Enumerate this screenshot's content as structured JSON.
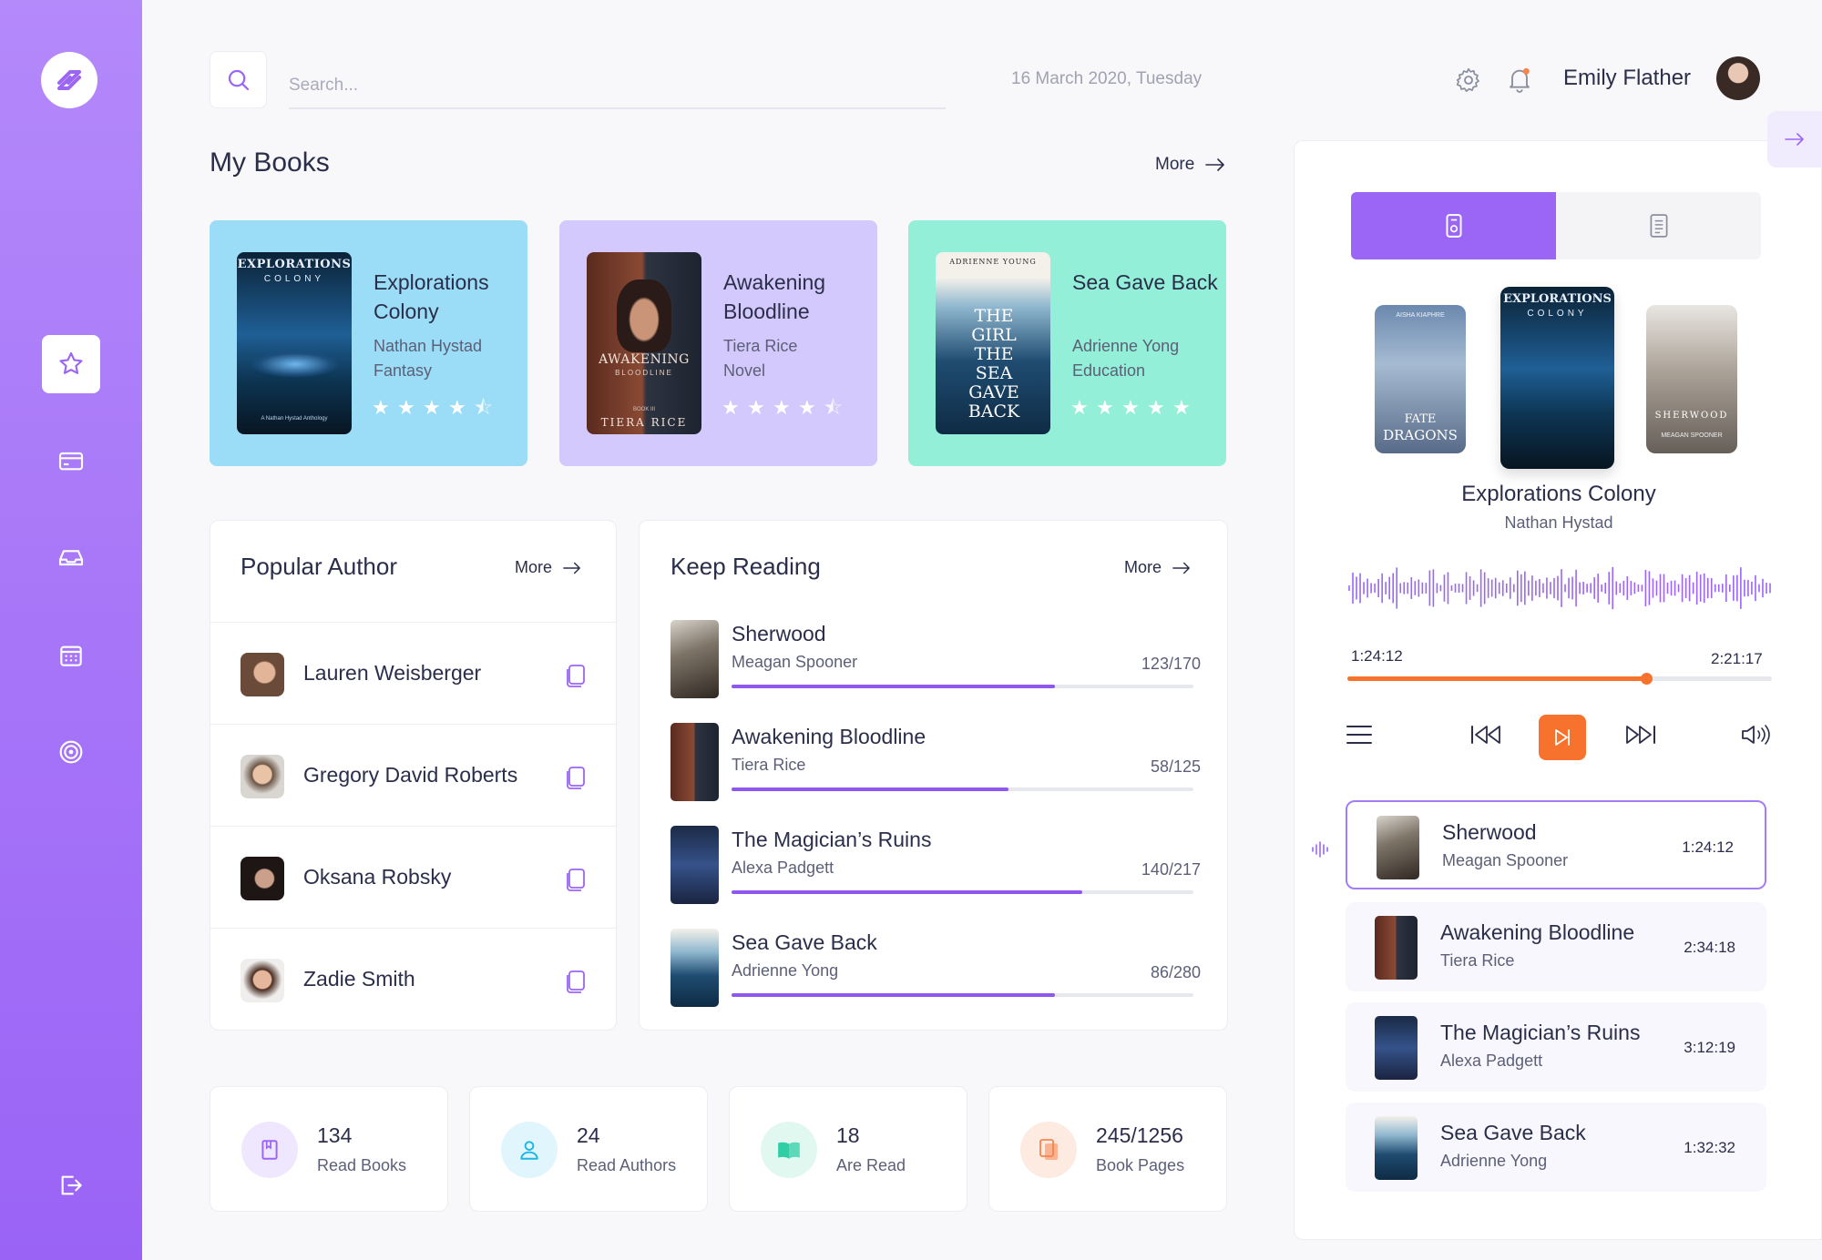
{
  "search": {
    "placeholder": "Search..."
  },
  "header": {
    "date": "16 March 2020, Tuesday",
    "user_name": "Emily Flather"
  },
  "sidebar": {
    "items": [
      {
        "icon": "star-icon"
      },
      {
        "icon": "card-icon"
      },
      {
        "icon": "inbox-icon"
      },
      {
        "icon": "calendar-icon"
      },
      {
        "icon": "target-icon"
      }
    ],
    "logout_icon": "logout-icon"
  },
  "my_books": {
    "title": "My Books",
    "more": "More",
    "cards": [
      {
        "title": "Explorations Colony",
        "author": "Nathan Hystad",
        "genre": "Fantasy",
        "rating": 4.5,
        "bg": "#9bdcf6"
      },
      {
        "title": "Awakening Bloodline",
        "author": "Tiera Rice",
        "genre": "Novel",
        "rating": 4.5,
        "bg": "#d3c9fc"
      },
      {
        "title": "Sea Gave Back",
        "author": "Adrienne Yong",
        "genre": "Education",
        "rating": 5,
        "bg": "#93efd7"
      }
    ]
  },
  "popular_author": {
    "title": "Popular Author",
    "more": "More",
    "authors": [
      {
        "name": "Lauren Weisberger"
      },
      {
        "name": "Gregory David Roberts"
      },
      {
        "name": "Oksana Robsky"
      },
      {
        "name": "Zadie Smith"
      }
    ]
  },
  "keep_reading": {
    "title": "Keep Reading",
    "more": "More",
    "items": [
      {
        "title": "Sherwood",
        "author": "Meagan Spooner",
        "count": "123/170",
        "progress": 0.7
      },
      {
        "title": "Awakening Bloodline",
        "author": "Tiera Rice",
        "count": "58/125",
        "progress": 0.6
      },
      {
        "title": "The Magician’s Ruins",
        "author": "Alexa Padgett",
        "count": "140/217",
        "progress": 0.76
      },
      {
        "title": "Sea Gave Back",
        "author": "Adrienne Yong",
        "count": "86/280",
        "progress": 0.7
      }
    ]
  },
  "stats": [
    {
      "value": "134",
      "label": "Read Books",
      "color": "#9b65f6"
    },
    {
      "value": "24",
      "label": "Read Authors",
      "color": "#1db7e6"
    },
    {
      "value": "18",
      "label": "Are Read",
      "color": "#2fcfa6"
    },
    {
      "value": "245/1256",
      "label": "Book Pages",
      "color": "#f7844d"
    }
  ],
  "player": {
    "now_playing": {
      "title": "Explorations Colony",
      "author": "Nathan Hystad"
    },
    "elapsed": "1:24:12",
    "total": "2:21:17",
    "progress": 0.703,
    "covers": [
      {
        "lines": [
          "AISHA KIAPHRE",
          "FATE",
          "DRAGONS"
        ]
      },
      {
        "lines": [
          "EXPLORATIONS",
          "COLONY"
        ]
      },
      {
        "lines": [
          "SHERWOOD",
          "MEAGAN SPOONER"
        ]
      }
    ],
    "playlist": [
      {
        "title": "Sherwood",
        "author": "Meagan Spooner",
        "time": "1:24:12",
        "active": true
      },
      {
        "title": "Awakening Bloodline",
        "author": "Tiera Rice",
        "time": "2:34:18",
        "active": false
      },
      {
        "title": "The Magician’s Ruins",
        "author": "Alexa Padgett",
        "time": "3:12:19",
        "active": false
      },
      {
        "title": "Sea Gave Back",
        "author": "Adrienne Yong",
        "time": "1:32:32",
        "active": false
      }
    ]
  },
  "covers_text": {
    "explorations": [
      "EXPLORATIONS",
      "COLONY",
      "A Nathan Hystad Anthology"
    ],
    "awakening": [
      "AWAKENING",
      "BLOODLINE",
      "BOOK III",
      "TIERA RICE"
    ],
    "seagaveback": [
      "ADRIENNE YOUNG",
      "THE GIRL THE SEA GAVE BACK"
    ]
  },
  "colors": {
    "accent": "#9b65f6",
    "orange": "#f7722c",
    "progress_purple": "#8e57f0"
  }
}
